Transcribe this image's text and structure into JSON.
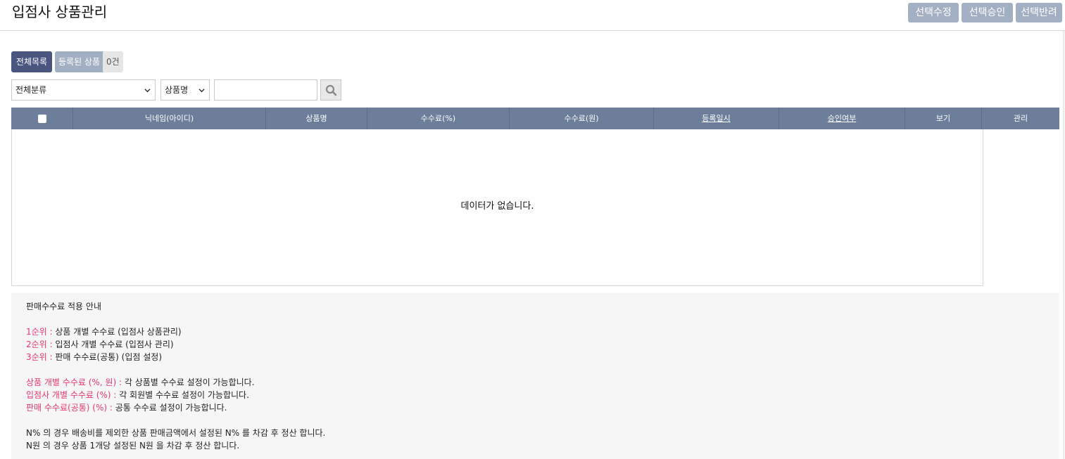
{
  "header": {
    "title": "입점사 상품관리",
    "buttons": [
      "선택수정",
      "선택승인",
      "선택반려"
    ]
  },
  "tabs": {
    "all_label": "전체목록",
    "registered_label": "등록된 상품",
    "registered_count": "0건"
  },
  "filters": {
    "category_value": "전체분류",
    "field_value": "상품명",
    "search_value": ""
  },
  "table": {
    "columns": [
      "닉네임(아이디)",
      "상품명",
      "수수료(%)",
      "수수료(원)",
      "등록일시",
      "승인여부",
      "보기",
      "관리"
    ],
    "empty_message": "데이터가 없습니다."
  },
  "notice": {
    "title": "판매수수료 적용 안내",
    "priority": [
      {
        "label": "1순위 :",
        "text": " 상품 개별 수수료 (입점사 상품관리)"
      },
      {
        "label": "2순위 :",
        "text": " 입점사 개별 수수료 (입점사 관리)"
      },
      {
        "label": "3순위 :",
        "text": " 판매 수수료(공통) (입점 설정)"
      }
    ],
    "fees": [
      {
        "label": "상품 개별 수수료 (%, 원) :",
        "text": " 각 상품별 수수료 설정이 가능합니다."
      },
      {
        "label": "입점사 개별 수수료 (%) :",
        "text": " 각 회원별 수수료 설정이 가능합니다."
      },
      {
        "label": "판매 수수료(공통) (%) :",
        "text": " 공통 수수료 설정이 가능합니다."
      }
    ],
    "settlement": [
      "N% 의 경우 배송비를 제외한 상품 판매금액에서 설정된 N% 를 차감 후 정산 합니다.",
      "N원 의 경우 상품 1개당 설정된 N원 을 차감 후 정산 합니다."
    ]
  },
  "colors": {
    "primary": "#4b5680",
    "button": "#a3afc3",
    "table_header": "#6c7e99",
    "highlight": "#e6386b"
  }
}
